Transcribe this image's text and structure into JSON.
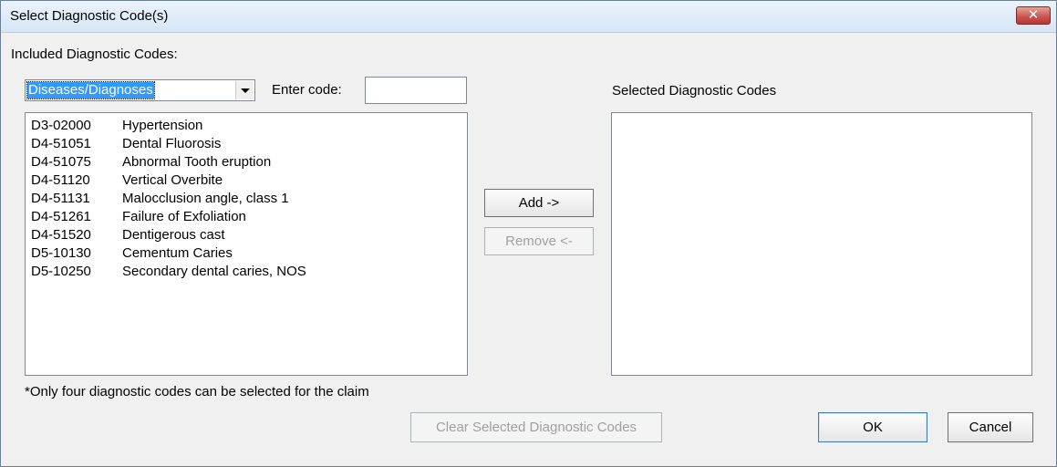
{
  "window": {
    "title": "Select Diagnostic Code(s)"
  },
  "left_panel": {
    "heading": "Included Diagnostic Codes:",
    "category_select": {
      "value": "Diseases/Diagnoses"
    },
    "enter_code_label": "Enter code:",
    "enter_code_value": "",
    "codes": [
      {
        "code": "D3-02000",
        "description": "Hypertension"
      },
      {
        "code": "D4-51051",
        "description": "Dental Fluorosis"
      },
      {
        "code": "D4-51075",
        "description": "Abnormal Tooth eruption"
      },
      {
        "code": "D4-51120",
        "description": "Vertical Overbite"
      },
      {
        "code": "D4-51131",
        "description": "Malocclusion angle, class 1"
      },
      {
        "code": "D4-51261",
        "description": "Failure of Exfoliation"
      },
      {
        "code": "D4-51520",
        "description": "Dentigerous cast"
      },
      {
        "code": "D5-10130",
        "description": "Cementum Caries"
      },
      {
        "code": "D5-10250",
        "description": "Secondary dental caries, NOS"
      }
    ]
  },
  "right_panel": {
    "heading": "Selected Diagnostic Codes",
    "codes": []
  },
  "buttons": {
    "add": "Add ->",
    "remove": "Remove <-",
    "clear": "Clear Selected Diagnostic Codes",
    "ok": "OK",
    "cancel": "Cancel"
  },
  "footnote": "*Only four diagnostic codes can be selected for the claim",
  "icons": {
    "close": "close-icon",
    "dropdown": "chevron-down-icon"
  },
  "colors": {
    "selection": "#3399ff",
    "close_button": "#c75050"
  }
}
